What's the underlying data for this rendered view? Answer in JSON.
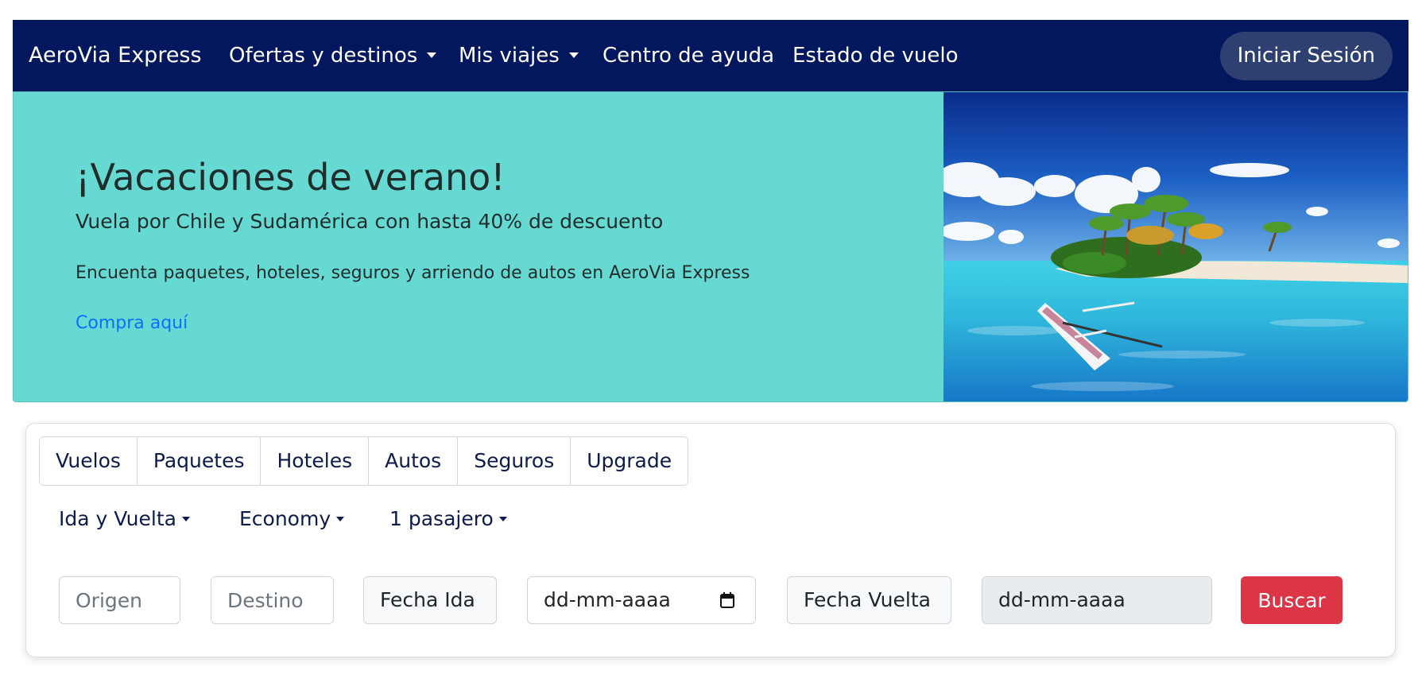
{
  "navbar": {
    "brand": "AeroVia Express",
    "items": [
      {
        "label": "Ofertas y destinos",
        "dropdown": true
      },
      {
        "label": "Mis viajes",
        "dropdown": true
      },
      {
        "label": "Centro de ayuda",
        "dropdown": false
      },
      {
        "label": "Estado de vuelo",
        "dropdown": false
      }
    ],
    "login_label": "Iniciar Sesión",
    "background": "#03175f"
  },
  "hero": {
    "title": "¡Vacaciones de verano!",
    "subtitle": "Vuela por Chile y Sudamérica con hasta 40% de descuento",
    "text": "Encuenta paquetes, hoteles, seguros y arriendo de autos en AeroVia Express",
    "link": "Compra aquí",
    "background": "#66d9d3",
    "image": "tropical-island-beach-with-canoe"
  },
  "search": {
    "tabs": [
      "Vuelos",
      "Paquetes",
      "Hoteles",
      "Autos",
      "Seguros",
      "Upgrade"
    ],
    "options": {
      "trip_type": "Ida y Vuelta",
      "cabin": "Economy",
      "passengers": "1 pasajero"
    },
    "origin_placeholder": "Origen",
    "destination_placeholder": "Destino",
    "departure_label": "Fecha Ida",
    "departure_value": "dd-mm-aaaa",
    "return_label": "Fecha Vuelta",
    "return_value": "dd-mm-aaaa",
    "search_label": "Buscar",
    "search_color": "#dc3545"
  }
}
